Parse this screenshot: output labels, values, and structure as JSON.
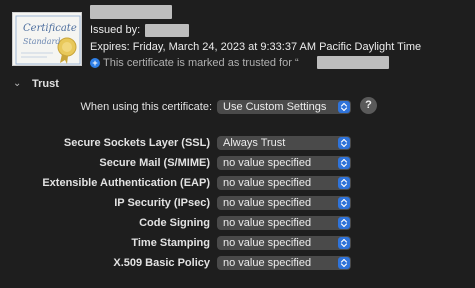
{
  "certificate": {
    "icon_script_title": "Certificate",
    "icon_script_sub": "Standard",
    "issued_by_label": "Issued by:",
    "expires_text": "Expires: Friday, March 24, 2023 at 9:33:37 AM Pacific Daylight Time",
    "trusted_text": "This certificate is marked as trusted for “"
  },
  "trust": {
    "section_label": "Trust",
    "when_using_label": "When using this certificate:",
    "when_using_value": "Use Custom Settings",
    "help_label": "?",
    "rows": [
      {
        "label": "Secure Sockets Layer (SSL)",
        "value": "Always Trust"
      },
      {
        "label": "Secure Mail (S/MIME)",
        "value": "no value specified"
      },
      {
        "label": "Extensible Authentication (EAP)",
        "value": "no value specified"
      },
      {
        "label": "IP Security (IPsec)",
        "value": "no value specified"
      },
      {
        "label": "Code Signing",
        "value": "no value specified"
      },
      {
        "label": "Time Stamping",
        "value": "no value specified"
      },
      {
        "label": "X.509 Basic Policy",
        "value": "no value specified"
      }
    ]
  },
  "colors": {
    "background": "#1e1e1e",
    "accent": "#2f73d9",
    "popup": "#4a4a4a"
  }
}
